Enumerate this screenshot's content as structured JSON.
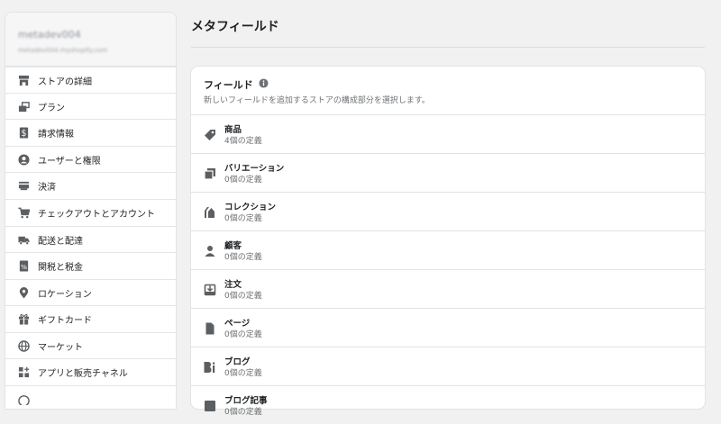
{
  "sidebar": {
    "store_name": "metadev004",
    "store_url": "metadev004.myshopify.com",
    "items": [
      {
        "label": "ストアの詳細",
        "icon": "store-icon"
      },
      {
        "label": "プラン",
        "icon": "plan-icon"
      },
      {
        "label": "請求情報",
        "icon": "billing-icon"
      },
      {
        "label": "ユーザーと権限",
        "icon": "user-icon"
      },
      {
        "label": "決済",
        "icon": "payment-card-icon"
      },
      {
        "label": "チェックアウトとアカウント",
        "icon": "cart-icon"
      },
      {
        "label": "配送と配達",
        "icon": "truck-icon"
      },
      {
        "label": "関税と税金",
        "icon": "tax-icon"
      },
      {
        "label": "ロケーション",
        "icon": "location-pin-icon"
      },
      {
        "label": "ギフトカード",
        "icon": "gift-icon"
      },
      {
        "label": "マーケット",
        "icon": "globe-icon"
      },
      {
        "label": "アプリと販売チャネル",
        "icon": "apps-icon"
      }
    ]
  },
  "main": {
    "title": "メタフィールド",
    "card": {
      "title": "フィールド",
      "subtitle": "新しいフィールドを追加するストアの構成部分を選択します。",
      "rows": [
        {
          "name": "商品",
          "count": "4個の定義",
          "icon": "tag-icon"
        },
        {
          "name": "バリエーション",
          "count": "0個の定義",
          "icon": "variants-icon"
        },
        {
          "name": "コレクション",
          "count": "0個の定義",
          "icon": "collection-icon"
        },
        {
          "name": "顧客",
          "count": "0個の定義",
          "icon": "customer-icon"
        },
        {
          "name": "注文",
          "count": "0個の定義",
          "icon": "order-icon"
        },
        {
          "name": "ページ",
          "count": "0個の定義",
          "icon": "page-icon"
        },
        {
          "name": "ブログ",
          "count": "0個の定義",
          "icon": "blog-icon"
        },
        {
          "name": "ブログ記事",
          "count": "0個の定義",
          "icon": "blog-post-icon"
        }
      ]
    }
  },
  "colors": {
    "icon": "#5c5f62",
    "text": "#202223",
    "subdued": "#6d7175",
    "background": "#f1f1f1"
  }
}
